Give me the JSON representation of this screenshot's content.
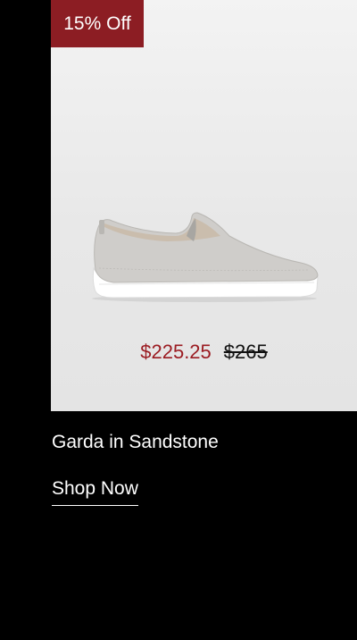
{
  "product": {
    "badge": "15% Off",
    "image_icon": "slip-on-sneaker-image",
    "sale_price": "$225.25",
    "original_price": "$265",
    "name": "Garda in Sandstone",
    "cta_label": "Shop Now"
  },
  "colors": {
    "badge_bg": "#8c1d23",
    "sale_price": "#9b1c22",
    "page_bg": "#000000",
    "image_bg": "#ebebeb"
  }
}
